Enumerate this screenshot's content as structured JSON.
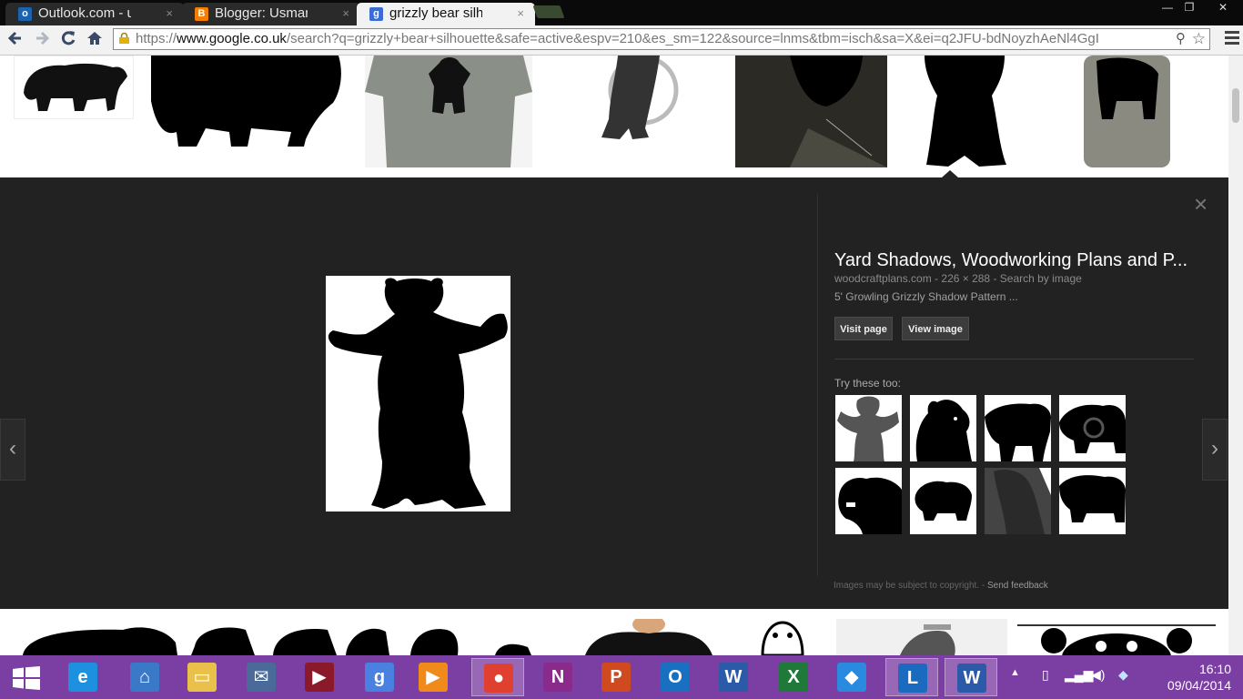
{
  "browser": {
    "tabs": [
      {
        "label": "Outlook.com - uzzyo",
        "icon": "outlook-icon",
        "color": "#1a63b0"
      },
      {
        "label": "Blogger: Usman Sabi",
        "icon": "blogger-icon",
        "color": "#f57d00"
      },
      {
        "label": "grizzly bear silhouett",
        "icon": "google-icon",
        "color": "#3b6bd6"
      }
    ],
    "close_tab": "×",
    "window_controls": {
      "minimize": "—",
      "restore": "❐",
      "close": "✕"
    },
    "url_scheme": "https://",
    "url_host": "www.google.co.uk",
    "url_rest": "/search?q=grizzly+bear+silhouette&safe=active&espv=210&es_sm=122&source=lnms&tbm=isch&sa=X&ei=q2JFU-bdNoyzhAeNl4GgI"
  },
  "preview": {
    "title": "Yard Shadows, Woodworking Plans and P...",
    "source": "woodcraftplans.com",
    "sep": " - ",
    "dims": "226 × 288",
    "search_by_image": "Search by image",
    "description": "5' Growling Grizzly Shadow Pattern ...",
    "visit_button": "Visit page",
    "view_button": "View image",
    "try_label": "Try these too:",
    "copyright": "Images may be subject to copyright.",
    "feedback": "Send feedback",
    "close": "×",
    "prev": "‹",
    "next": "›"
  },
  "taskbar": {
    "time": "16:10",
    "date": "09/04/2014",
    "apps": [
      {
        "name": "internet-explorer",
        "glyph": "e",
        "color": "#1e90e0"
      },
      {
        "name": "remote-desktop",
        "glyph": "⌂",
        "color": "#3a78c8"
      },
      {
        "name": "file-explorer",
        "glyph": "▭",
        "color": "#e8c04a"
      },
      {
        "name": "messaging",
        "glyph": "✉",
        "color": "#4a6a9a"
      },
      {
        "name": "media-player",
        "glyph": "▶",
        "color": "#8a1a2a"
      },
      {
        "name": "google-search",
        "glyph": "g",
        "color": "#4a80e0"
      },
      {
        "name": "video",
        "glyph": "▶",
        "color": "#f08a1a"
      },
      {
        "name": "chrome",
        "glyph": "●",
        "color": "#e04030"
      },
      {
        "name": "onenote",
        "glyph": "N",
        "color": "#8a2a8a"
      },
      {
        "name": "powerpoint",
        "glyph": "P",
        "color": "#d04a20"
      },
      {
        "name": "outlook",
        "glyph": "O",
        "color": "#1a70c0"
      },
      {
        "name": "word",
        "glyph": "W",
        "color": "#2a5aa8"
      },
      {
        "name": "excel",
        "glyph": "X",
        "color": "#1f7a3a"
      },
      {
        "name": "dropbox",
        "glyph": "◆",
        "color": "#2a8ae0"
      },
      {
        "name": "lync",
        "glyph": "L",
        "color": "#1a6ac0"
      },
      {
        "name": "word-2",
        "glyph": "W",
        "color": "#2a5aa8"
      }
    ]
  }
}
